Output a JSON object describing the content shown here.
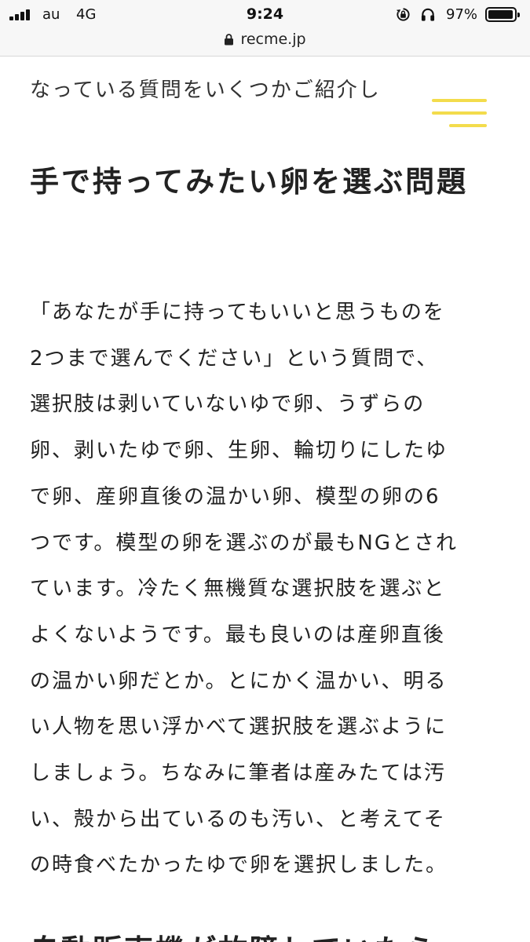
{
  "status_bar": {
    "carrier": "au",
    "network": "4G",
    "time": "9:24",
    "battery_percent": "97%",
    "battery_level": 0.97,
    "icons": [
      "signal-icon",
      "rotation-lock-icon",
      "headphones-icon",
      "battery-icon"
    ]
  },
  "browser": {
    "url": "recme.jp",
    "icons": [
      "lock-icon"
    ]
  },
  "article": {
    "intro_fragment": "なっている質問をいくつかご紹介し",
    "heading": "手で持ってみたい卵を選ぶ問題",
    "body_lines": [
      "「あなたが手に持ってもいいと思うものを",
      "2つまで選んでください」という質問で、",
      "選択肢は剥いていないゆで卵、うずらの",
      "卵、剥いたゆで卵、生卵、輪切りにしたゆ",
      "で卵、産卵直後の温かい卵、模型の卵の6",
      "つです。模型の卵を選ぶのが最もNGとされ",
      "ています。冷たく無機質な選択肢を選ぶと",
      "よくないようです。最も良いのは産卵直後",
      "の温かい卵だとか。とにかく温かい、明る",
      "い人物を思い浮かべて選択肢を選ぶように",
      "しましょう。ちなみに筆者は産みたては汚",
      "い、殻から出ているのも汚い、と考えてそ",
      "の時食べたかったゆで卵を選択しました。"
    ],
    "next_heading_partial": "自動販売機が故障していたら"
  },
  "colors": {
    "menu_accent": "#f3dc4c",
    "text": "#222222",
    "bar_background": "#f7f7f7"
  }
}
